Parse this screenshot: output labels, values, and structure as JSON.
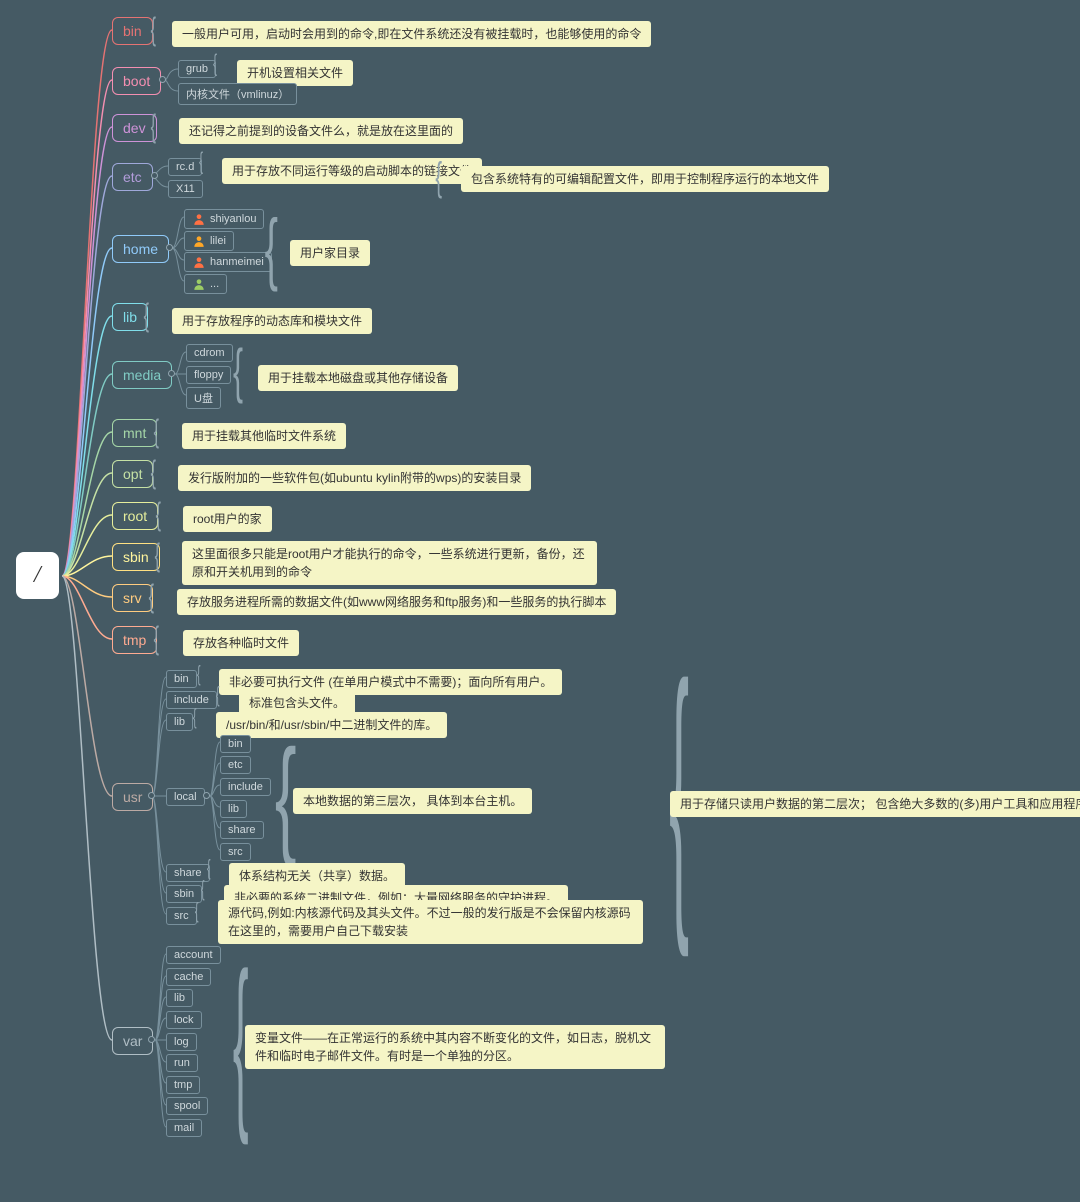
{
  "root": "/",
  "bin": {
    "label": "bin",
    "desc": "一般用户可用，启动时会用到的命令,即在文件系统还没有被挂载时，也能够使用的命令"
  },
  "boot": {
    "label": "boot",
    "grub": "grub",
    "grub_desc": "开机设置相关文件",
    "kernel": "内核文件（vmlinuz）"
  },
  "dev": {
    "label": "dev",
    "desc": "还记得之前提到的设备文件么，就是放在这里面的"
  },
  "etc": {
    "label": "etc",
    "rcd": "rc.d",
    "rcd_desc": "用于存放不同运行等级的启动脚本的链接文件",
    "x11": "X11",
    "desc": "包含系统特有的可编辑配置文件，即用于控制程序运行的本地文件"
  },
  "home": {
    "label": "home",
    "u1": "shiyanlou",
    "u2": "lilei",
    "u3": "hanmeimei",
    "u4": "...",
    "desc": "用户家目录"
  },
  "lib": {
    "label": "lib",
    "desc": "用于存放程序的动态库和模块文件"
  },
  "media": {
    "label": "media",
    "c1": "cdrom",
    "c2": "floppy",
    "c3": "U盘",
    "desc": "用于挂载本地磁盘或其他存储设备"
  },
  "mnt": {
    "label": "mnt",
    "desc": "用于挂载其他临时文件系统"
  },
  "opt": {
    "label": "opt",
    "desc": "发行版附加的一些软件包(如ubuntu kylin附带的wps)的安装目录"
  },
  "rootdir": {
    "label": "root",
    "desc": "root用户的家"
  },
  "sbin": {
    "label": "sbin",
    "desc": "这里面很多只能是root用户才能执行的命令，一些系统进行更新，备份，还原和开关机用到的命令"
  },
  "srv": {
    "label": "srv",
    "desc": "存放服务进程所需的数据文件(如www网络服务和ftp服务)和一些服务的执行脚本"
  },
  "tmp": {
    "label": "tmp",
    "desc": "存放各种临时文件"
  },
  "usr": {
    "label": "usr",
    "bin": "bin",
    "bin_desc": "非必要可执行文件 (在单用户模式中不需要)；面向所有用户。",
    "include": "include",
    "include_desc": "标准包含头文件。",
    "lib": "lib",
    "lib_desc": "/usr/bin/和/usr/sbin/中二进制文件的库。",
    "local": "local",
    "local_desc": "本地数据的第三层次， 具体到本台主机。",
    "local_sub": {
      "bin": "bin",
      "etc": "etc",
      "include": "include",
      "lib": "lib",
      "share": "share",
      "src": "src"
    },
    "share": "share",
    "share_desc": "体系结构无关（共享）数据。",
    "sbin": "sbin",
    "sbin_desc": "非必要的系统二进制文件，例如：大量网络服务的守护进程。",
    "src": "src",
    "src_desc": "源代码,例如:内核源代码及其头文件。不过一般的发行版是不会保留内核源码在这里的，需要用户自己下载安装",
    "desc": "用于存储只读用户数据的第二层次； 包含绝大多数的(多)用户工具和应用程序"
  },
  "var": {
    "label": "var",
    "items": {
      "account": "account",
      "cache": "cache",
      "lib": "lib",
      "lock": "lock",
      "log": "log",
      "run": "run",
      "tmp": "tmp",
      "spool": "spool",
      "mail": "mail"
    },
    "desc": "变量文件——在正常运行的系统中其内容不断变化的文件，如日志，脱机文件和临时电子邮件文件。有时是一个单独的分区。"
  }
}
